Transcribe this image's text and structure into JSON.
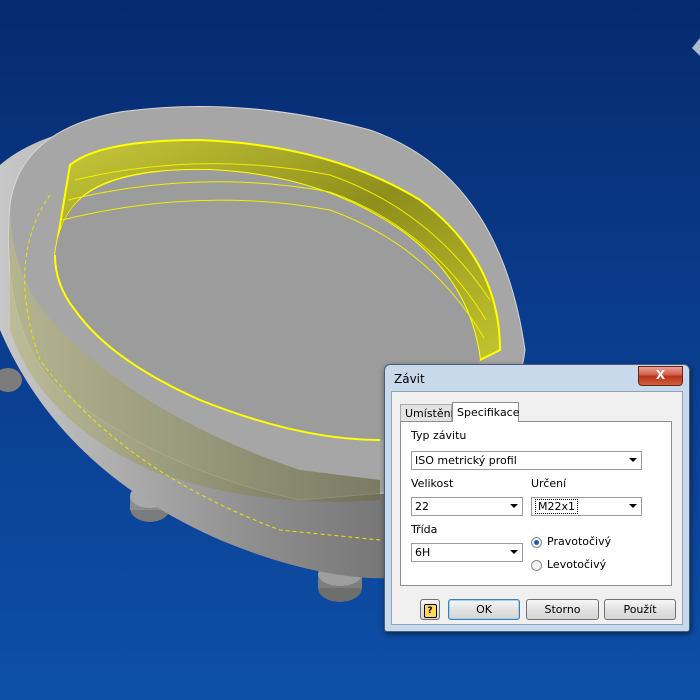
{
  "dialog": {
    "title": "Závit",
    "close_label": "X",
    "tabs": [
      {
        "label": "Umístění",
        "active": false
      },
      {
        "label": "Specifikace",
        "active": true
      }
    ],
    "thread_type": {
      "label": "Typ závitu",
      "value": "ISO metrický profil"
    },
    "size": {
      "label": "Velikost",
      "value": "22"
    },
    "designation": {
      "label": "Určení",
      "value": "M22x1"
    },
    "class": {
      "label": "Třída",
      "value": "6H"
    },
    "direction": {
      "right": {
        "label": "Pravotočivý",
        "selected": true
      },
      "left": {
        "label": "Levotočivý",
        "selected": false
      }
    },
    "buttons": {
      "help_glyph": "?",
      "ok": "OK",
      "cancel": "Storno",
      "apply": "Použít"
    }
  },
  "colors": {
    "background_top": "#062a6e",
    "background_bottom": "#0d4fa8",
    "part": "#a9a9a9",
    "thread_highlight": "#e6e600",
    "dialog_frame": "#c9d9ec"
  }
}
